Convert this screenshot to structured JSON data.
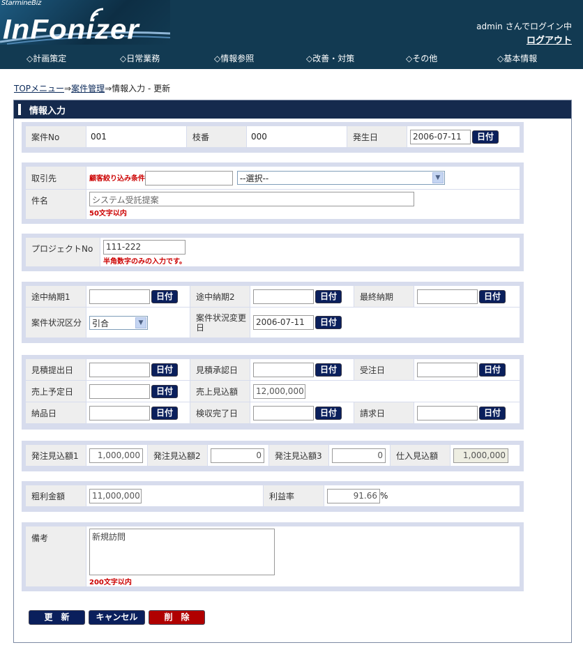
{
  "header": {
    "logo_small": "StarmineBiz",
    "logo_main": "InFonizer",
    "user_text": "admin さんでログイン中",
    "logout_label": "ログアウト"
  },
  "nav": [
    "◇計画策定",
    "◇日常業務",
    "◇情報参照",
    "◇改善・対策",
    "◇その他",
    "◇基本情報"
  ],
  "breadcrumb": {
    "top": "TOPメニュー",
    "sep1": "⇒",
    "case_mgmt": "案件管理",
    "sep2": "⇒",
    "current": "情報入力 - 更新"
  },
  "panel_title": "情報入力",
  "date_button": "日付",
  "section1": {
    "case_no_label": "案件No",
    "case_no": "001",
    "branch_label": "枝番",
    "branch": "000",
    "date_label": "発生日",
    "date": "2006-07-11"
  },
  "section2": {
    "client_label": "取引先",
    "filter_label": "顧客絞り込み条件",
    "filter_value": "",
    "client_select": "--選択--",
    "subject_label": "件名",
    "subject_value": "システム受託提案",
    "subject_note": "50文字以内"
  },
  "section3": {
    "project_label": "プロジェクトNo",
    "project_value": "111-222",
    "project_note": "半角数字のみの入力です。"
  },
  "section4": {
    "mid1_label": "途中納期1",
    "mid2_label": "途中納期2",
    "final_label": "最終納期",
    "status_label": "案件状況区分",
    "status_value": "引合",
    "status_date_label": "案件状況変更日",
    "status_date": "2006-07-11"
  },
  "section5": {
    "quote_submit_label": "見積提出日",
    "quote_approve_label": "見積承認日",
    "order_label": "受注日",
    "sales_plan_label": "売上予定日",
    "sales_est_label": "売上見込額",
    "sales_est_value": "12,000,000",
    "delivery_label": "納品日",
    "inspection_label": "検収完了日",
    "invoice_label": "請求日"
  },
  "section6": {
    "po1_label": "発注見込額1",
    "po1": "1,000,000",
    "po2_label": "発注見込額2",
    "po2": "0",
    "po3_label": "発注見込額3",
    "po3": "0",
    "purchase_label": "仕入見込額",
    "purchase": "1,000,000"
  },
  "section7": {
    "gross_label": "粗利金額",
    "gross": "11,000,000",
    "margin_label": "利益率",
    "margin": "91.66",
    "margin_unit": "%"
  },
  "section8": {
    "remarks_label": "備考",
    "remarks_value": "新規訪問",
    "remarks_note": "200文字以内"
  },
  "buttons": {
    "update": "更　新",
    "cancel": "キャンセル",
    "delete": "削　除"
  },
  "colors": {
    "header": "#123a52",
    "panel_title": "#152a4d",
    "date_button": "#0a1f5c",
    "delete_button": "#b00000",
    "note": "#cc0000"
  }
}
